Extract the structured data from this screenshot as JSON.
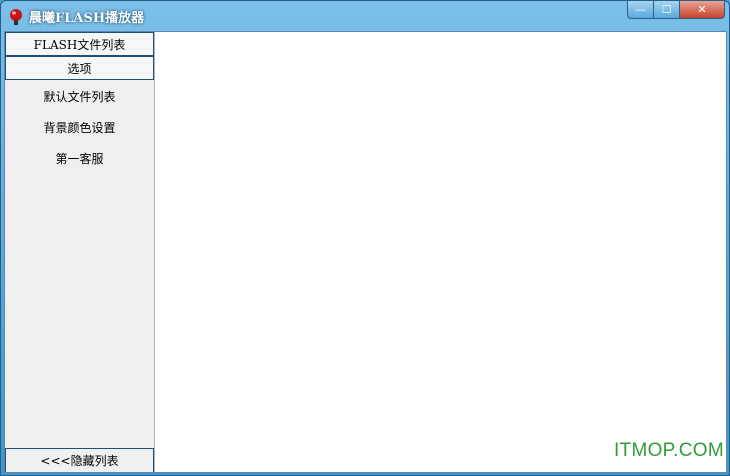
{
  "window": {
    "title": "晨曦FLASH播放器",
    "controls": {
      "minimize": "—",
      "maximize": "☐",
      "close": "✕"
    }
  },
  "sidebar": {
    "files_header": "FLASH文件列表",
    "options_header": "选项",
    "options": [
      {
        "label": "默认文件列表"
      },
      {
        "label": "背景颜色设置"
      },
      {
        "label": "第一客服"
      }
    ],
    "hide_button": "<<<隐藏列表"
  },
  "watermark": "ITMOP.COM",
  "colors": {
    "titlebar": "#4aa5d7",
    "close_button": "#c7432b",
    "sidebar_bg": "#efefef",
    "header_border": "#1f4f7d",
    "watermark": "#2f9d37"
  }
}
